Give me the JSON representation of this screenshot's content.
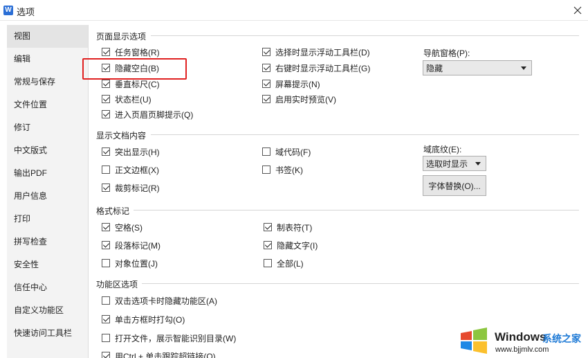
{
  "window": {
    "title": "选项",
    "app_icon_letter": "W"
  },
  "sidebar": {
    "items": [
      {
        "label": "视图",
        "active": true
      },
      {
        "label": "编辑"
      },
      {
        "label": "常规与保存"
      },
      {
        "label": "文件位置"
      },
      {
        "label": "修订"
      },
      {
        "label": "中文版式"
      },
      {
        "label": "输出PDF"
      },
      {
        "label": "用户信息"
      },
      {
        "label": "打印"
      },
      {
        "label": "拼写检查"
      },
      {
        "label": "安全性"
      },
      {
        "label": "信任中心"
      },
      {
        "label": "自定义功能区"
      },
      {
        "label": "快速访问工具栏"
      }
    ]
  },
  "page_display": {
    "title": "页面显示选项",
    "left": [
      {
        "label": "任务窗格(R)",
        "checked": true
      },
      {
        "label": "隐藏空白(B)",
        "checked": true
      },
      {
        "label": "垂直标尺(C)",
        "checked": true
      },
      {
        "label": "状态栏(U)",
        "checked": true
      },
      {
        "label": "进入页眉页脚提示(Q)",
        "checked": true
      }
    ],
    "middle": [
      {
        "label": "选择时显示浮动工具栏(D)",
        "checked": true
      },
      {
        "label": "右键时显示浮动工具栏(G)",
        "checked": true
      },
      {
        "label": "屏幕提示(N)",
        "checked": true
      },
      {
        "label": "启用实时预览(V)",
        "checked": true
      }
    ],
    "nav_pane_label": "导航窗格(P):",
    "nav_pane_value": "隐藏"
  },
  "doc_content": {
    "title": "显示文档内容",
    "left": [
      {
        "label": "突出显示(H)",
        "checked": true
      },
      {
        "label": "正文边框(X)",
        "checked": false
      },
      {
        "label": "裁剪标记(R)",
        "checked": true
      }
    ],
    "middle": [
      {
        "label": "域代码(F)",
        "checked": false
      },
      {
        "label": "书签(K)",
        "checked": false
      }
    ],
    "field_shading_label": "域底纹(E):",
    "field_shading_value": "选取时显示",
    "font_sub_button": "字体替换(O)..."
  },
  "format_marks": {
    "title": "格式标记",
    "left": [
      {
        "label": "空格(S)",
        "checked": true
      },
      {
        "label": "段落标记(M)",
        "checked": true
      },
      {
        "label": "对象位置(J)",
        "checked": false
      }
    ],
    "middle": [
      {
        "label": "制表符(T)",
        "checked": true
      },
      {
        "label": "隐藏文字(I)",
        "checked": true
      },
      {
        "label": "全部(L)",
        "checked": false
      }
    ]
  },
  "ribbon": {
    "title": "功能区选项",
    "items": [
      {
        "label": "双击选项卡时隐藏功能区(A)",
        "checked": false
      },
      {
        "label": "单击方框时打勾(O)",
        "checked": true
      },
      {
        "label": "打开文件，展示智能识别目录(W)",
        "checked": false
      },
      {
        "label": "用Ctrl + 单击跟踪超链接(O)",
        "checked": true
      }
    ]
  },
  "watermark": {
    "brand": "Windows",
    "cn": "系统之家",
    "url": "www.bjjmlv.com"
  },
  "colors": {
    "highlight": "#e02020",
    "accent": "#1e7ad6"
  }
}
